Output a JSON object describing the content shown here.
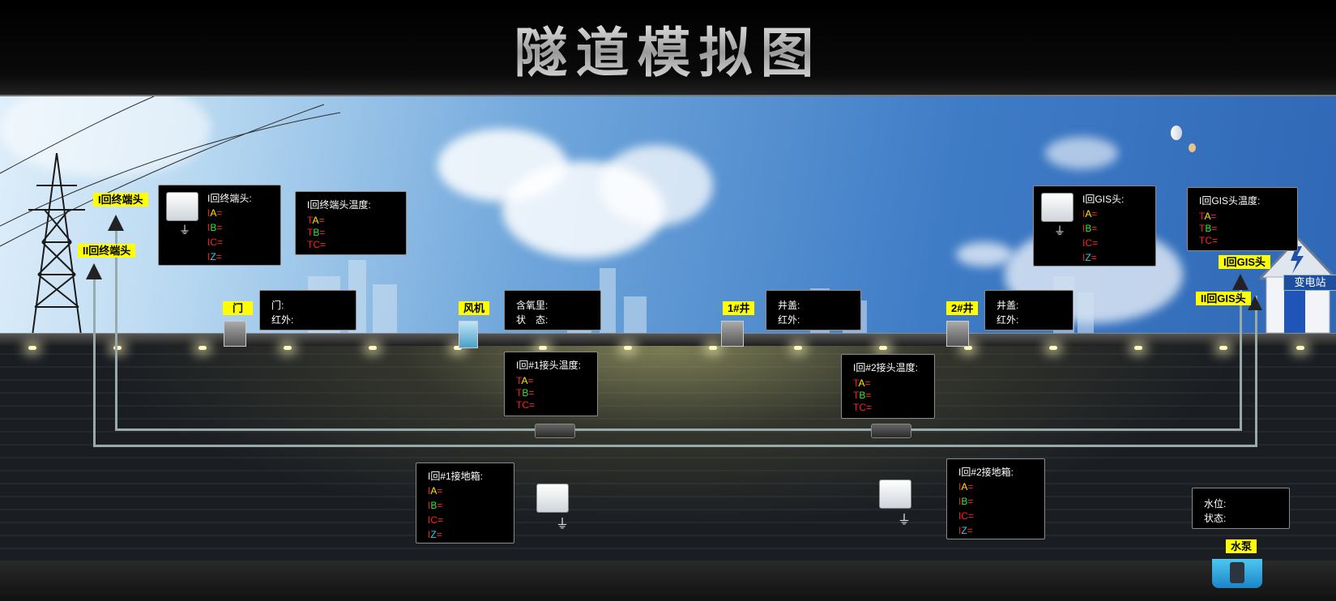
{
  "title": "隧道模拟图",
  "tags": {
    "loop1_terminal": "I回终端头",
    "loop2_terminal": "II回终端头",
    "door": "门",
    "fan": "风机",
    "well1": "1#井",
    "well2": "2#井",
    "loop1_gis": "I回GIS头",
    "loop2_gis": "II回GIS头",
    "pump": "水泵",
    "substation": "变电站"
  },
  "panels": {
    "terminal_current": {
      "title": "I回终端头:",
      "rows": [
        {
          "p": "I",
          "s": "A",
          "e": "="
        },
        {
          "p": "I",
          "s": "B",
          "e": "="
        },
        {
          "p": "I",
          "s": "C",
          "e": "="
        },
        {
          "p": "I",
          "s": "Z",
          "e": "="
        }
      ]
    },
    "terminal_temp": {
      "title": "I回终端头温度:",
      "rows": [
        {
          "p": "T",
          "s": "A",
          "e": "="
        },
        {
          "p": "T",
          "s": "B",
          "e": "="
        },
        {
          "p": "T",
          "s": "C",
          "e": "="
        }
      ]
    },
    "door": {
      "rows": [
        "门:",
        "红外:"
      ]
    },
    "fan": {
      "rows": [
        "含氧里:",
        "状　态:"
      ]
    },
    "well1": {
      "rows": [
        "井盖:",
        "红外:"
      ]
    },
    "well2": {
      "rows": [
        "井盖:",
        "红外:"
      ]
    },
    "gis_current": {
      "title": "I回GIS头:",
      "rows": [
        {
          "p": "I",
          "s": "A",
          "e": "="
        },
        {
          "p": "I",
          "s": "B",
          "e": "="
        },
        {
          "p": "I",
          "s": "C",
          "e": "="
        },
        {
          "p": "I",
          "s": "Z",
          "e": "="
        }
      ]
    },
    "gis_temp": {
      "title": "I回GIS头温度:",
      "rows": [
        {
          "p": "T",
          "s": "A",
          "e": "="
        },
        {
          "p": "T",
          "s": "B",
          "e": "="
        },
        {
          "p": "T",
          "s": "C",
          "e": "="
        }
      ]
    },
    "joint1_temp": {
      "title": "I回#1接头温度:",
      "rows": [
        {
          "p": "T",
          "s": "A",
          "e": "="
        },
        {
          "p": "T",
          "s": "B",
          "e": "="
        },
        {
          "p": "T",
          "s": "C",
          "e": "="
        }
      ]
    },
    "joint2_temp": {
      "title": "I回#2接头温度:",
      "rows": [
        {
          "p": "T",
          "s": "A",
          "e": "="
        },
        {
          "p": "T",
          "s": "B",
          "e": "="
        },
        {
          "p": "T",
          "s": "C",
          "e": "="
        }
      ]
    },
    "ground1": {
      "title": "I回#1接地箱:",
      "rows": [
        {
          "p": "I",
          "s": "A",
          "e": "="
        },
        {
          "p": "I",
          "s": "B",
          "e": "="
        },
        {
          "p": "I",
          "s": "C",
          "e": "="
        },
        {
          "p": "I",
          "s": "Z",
          "e": "="
        }
      ]
    },
    "ground2": {
      "title": "I回#2接地箱:",
      "rows": [
        {
          "p": "I",
          "s": "A",
          "e": "="
        },
        {
          "p": "I",
          "s": "B",
          "e": "="
        },
        {
          "p": "I",
          "s": "C",
          "e": "="
        },
        {
          "p": "I",
          "s": "Z",
          "e": "="
        }
      ]
    },
    "pump": {
      "rows": [
        "水位:",
        "状态:"
      ]
    }
  },
  "colors": {
    "tag_bg": "#ffff00",
    "phase_A": "#ffea00",
    "phase_B": "#32e632",
    "phase_C": "#ff2020",
    "phase_Z": "#27d3e8",
    "label_red": "#ff2020"
  }
}
